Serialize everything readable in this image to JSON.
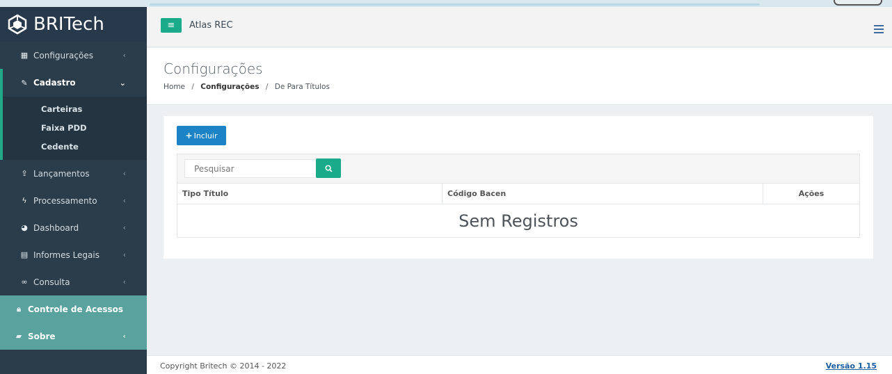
{
  "brand": {
    "name": "BRITech"
  },
  "header": {
    "app_title": "Atlas REC"
  },
  "sidebar": {
    "items": [
      {
        "label": "Configurações",
        "icon": "grid-icon"
      },
      {
        "label": "Cadastro",
        "icon": "edit-icon",
        "expanded": true,
        "children": [
          {
            "label": "Carteiras"
          },
          {
            "label": "Faixa PDD"
          },
          {
            "label": "Cedente"
          }
        ]
      },
      {
        "label": "Lançamentos",
        "icon": "upload-icon"
      },
      {
        "label": "Processamento",
        "icon": "bolt-icon"
      },
      {
        "label": "Dashboard",
        "icon": "pie-chart-icon"
      },
      {
        "label": "Informes Legais",
        "icon": "building-icon"
      },
      {
        "label": "Consulta",
        "icon": "binoculars-icon"
      },
      {
        "label": "Controle de Acessos",
        "icon": "lock-icon"
      },
      {
        "label": "Sobre",
        "icon": "book-icon"
      }
    ]
  },
  "page": {
    "title": "Configurações",
    "breadcrumb": {
      "home": "Home",
      "section": "Configurações",
      "current": "De Para Títulos",
      "separator": "/"
    }
  },
  "toolbar": {
    "add_label": "Incluir"
  },
  "search": {
    "placeholder": "Pesquisar",
    "value": ""
  },
  "table": {
    "columns": [
      "Tipo Título",
      "Código Bacen",
      "Ações"
    ],
    "empty_message": "Sem Registros"
  },
  "footer": {
    "copyright": "Copyright Britech © 2014 - 2022",
    "version": "Versão 1.15"
  },
  "colors": {
    "sidebar": "#2b3d4a",
    "accent": "#1aab8a",
    "primary": "#1c84c6",
    "teal": "#5aa29d"
  }
}
